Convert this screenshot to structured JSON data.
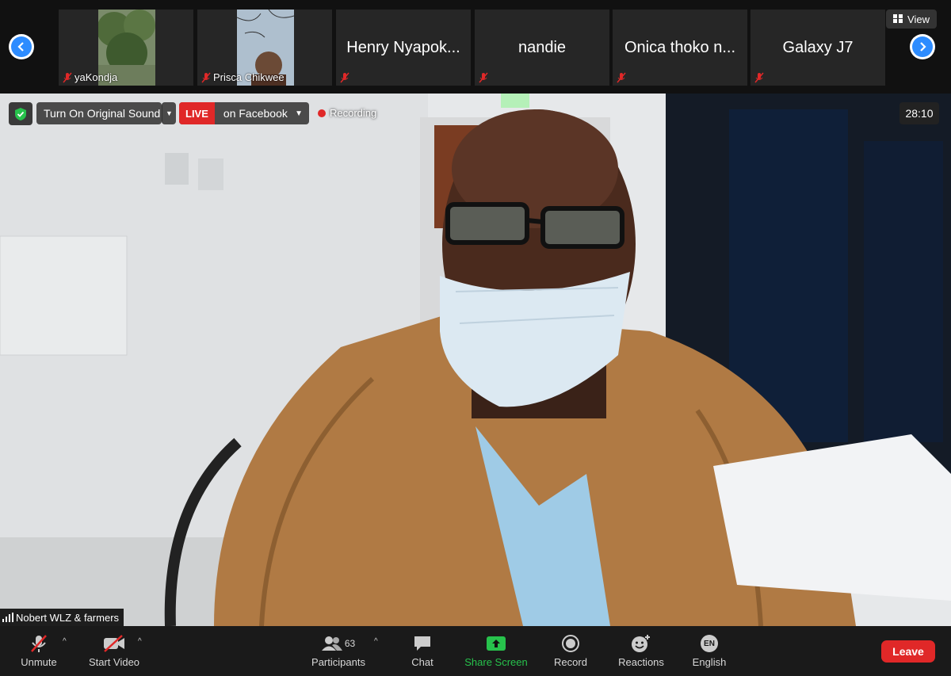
{
  "strip": {
    "participants": [
      {
        "name": "yaKondja"
      },
      {
        "name": "Prisca Chikwee"
      },
      {
        "name": "Henry Nyapok..."
      },
      {
        "name": "nandie"
      },
      {
        "name": "Onica thoko n..."
      },
      {
        "name": "Galaxy J7"
      }
    ],
    "view_label": "View"
  },
  "overlay": {
    "original_sound_label": "Turn On Original Sound",
    "live_badge": "LIVE",
    "live_target": "on Facebook",
    "recording_label": "Recording",
    "timer": "28:10",
    "active_speaker": "Nobert WLZ & farmers"
  },
  "toolbar": {
    "unmute": "Unmute",
    "start_video": "Start Video",
    "participants_label": "Participants",
    "participants_count": "63",
    "chat": "Chat",
    "share_screen": "Share Screen",
    "record": "Record",
    "reactions": "Reactions",
    "language_label": "English",
    "language_code": "EN",
    "leave": "Leave"
  },
  "colors": {
    "accent_blue": "#2d8cff",
    "live_red": "#e02828",
    "share_green": "#27c24c",
    "toolbar_bg": "#1a1a1a"
  }
}
